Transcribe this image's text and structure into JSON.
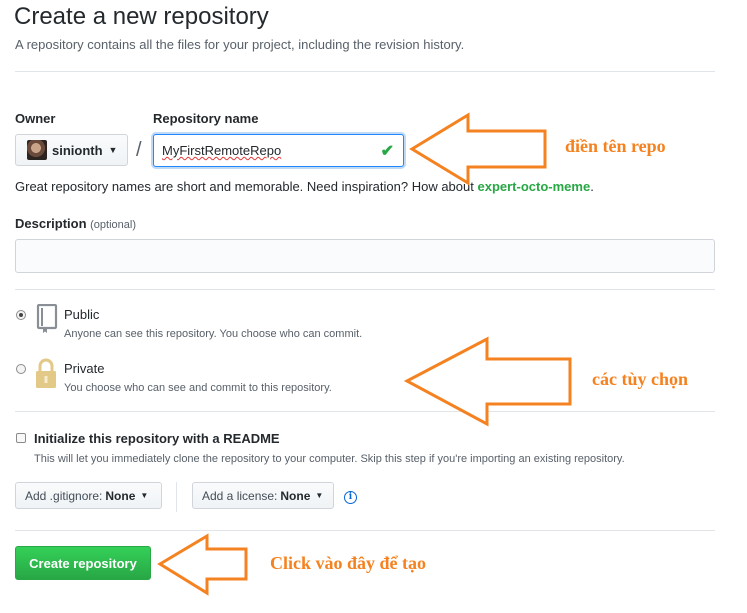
{
  "header": {
    "title": "Create a new repository",
    "subtitle": "A repository contains all the files for your project, including the revision history."
  },
  "owner": {
    "label": "Owner",
    "value": "sinionth"
  },
  "repository": {
    "label": "Repository name",
    "value": "MyFirstRemoteRepo",
    "separator": "/",
    "hint_prefix": "Great repository names are short and memorable. Need inspiration? How about",
    "hint_suggestion": "expert-octo-meme",
    "hint_suffix": "."
  },
  "description": {
    "label": "Description",
    "optional": "(optional)",
    "value": ""
  },
  "visibility": {
    "selected": "public",
    "public": {
      "title": "Public",
      "note": "Anyone can see this repository. You choose who can commit."
    },
    "private": {
      "title": "Private",
      "note": "You choose who can see and commit to this repository."
    }
  },
  "readme": {
    "title": "Initialize this repository with a README",
    "note": "This will let you immediately clone the repository to your computer. Skip this step if you're importing an existing repository.",
    "checked": false
  },
  "gitignore": {
    "label": "Add .gitignore:",
    "value": "None"
  },
  "license": {
    "label": "Add a license:",
    "value": "None"
  },
  "create_button": "Create repository",
  "annotations": {
    "fill_name": "điền tên repo",
    "options": "các tùy chọn",
    "click_create": "Click vào đây để tạo",
    "color": "#f58220"
  },
  "icons": {
    "check": "check-icon",
    "public": "repo-book-icon",
    "private": "lock-icon",
    "info": "info-icon"
  }
}
